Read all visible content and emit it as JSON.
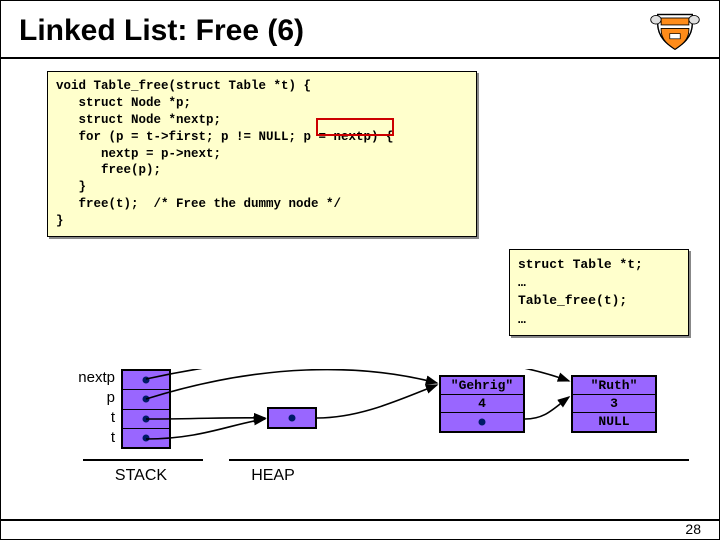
{
  "title": "Linked List: Free (6)",
  "code": {
    "l1": "void Table_free(struct Table *t) {",
    "l2": "   struct Node *p;",
    "l3": "   struct Node *nextp;",
    "l4": "   for (p = t->first; p != NULL; p = nextp) {",
    "l5": "      nextp = p->next;",
    "l6": "      free(p);",
    "l7": "   }",
    "l8": "   free(t);  /* Free the dummy node */",
    "l9": "}"
  },
  "caller": {
    "l1": "struct Table *t;",
    "l2": "…",
    "l3": "Table_free(t);",
    "l4": "…"
  },
  "stack_vars": [
    "nextp",
    "p",
    "t",
    "t"
  ],
  "labels": {
    "stack": "STACK",
    "heap": "HEAP"
  },
  "nodes": {
    "a": {
      "key": "\"Gehrig\"",
      "val": "4"
    },
    "b": {
      "key": "\"Ruth\"",
      "val": "3",
      "next": "NULL"
    }
  },
  "page": "28"
}
